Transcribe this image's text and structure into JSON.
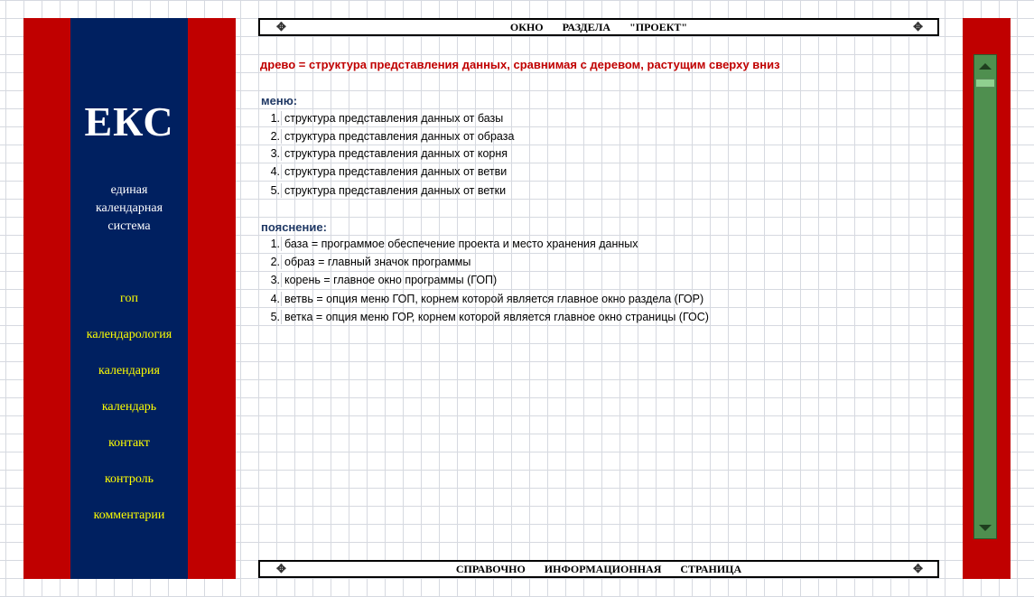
{
  "sidebar": {
    "logo": "ЕКС",
    "subtitle": [
      "единая",
      "календарная",
      "система"
    ],
    "nav": [
      "гоп",
      "календарология",
      "календария",
      "календарь",
      "контакт",
      "контроль",
      "комментарии"
    ]
  },
  "header": {
    "title": "ОКНО   РАЗДЕЛА   \"ПРОЕКТ\""
  },
  "footer": {
    "title": "СПРАВОЧНО   ИНФОРМАЦИОННАЯ   СТРАНИЦА"
  },
  "content": {
    "definition": "древо = структура представления данных, сравнимая с деревом, растущим сверху вниз",
    "menu_heading": "меню:",
    "menu_items": [
      {
        "num": "1.",
        "text": "структура представления данных от базы"
      },
      {
        "num": "2.",
        "text": "структура представления данных от образа"
      },
      {
        "num": "3.",
        "text": "структура представления данных от корня"
      },
      {
        "num": "4.",
        "text": "структура представления данных от ветви"
      },
      {
        "num": "5.",
        "text": "структура представления данных от ветки"
      }
    ],
    "explain_heading": "пояснение:",
    "explain_items": [
      {
        "num": "1.",
        "text": "база = программое обеспечение проекта и место хранения данных"
      },
      {
        "num": "2.",
        "text": "образ = главный значок программы"
      },
      {
        "num": "3.",
        "text": "корень = главное окно программы (ГОП)"
      },
      {
        "num": "4.",
        "text": "ветвь = опция меню ГОП, корнем которой является главное окно раздела (ГОР)"
      },
      {
        "num": "5.",
        "text": "ветка = опция меню ГОР, корнем которой является главное окно страницы (ГОС)"
      }
    ]
  },
  "icons": {
    "ornament": "compass-rose-icon",
    "scroll_up": "arrow-up-icon",
    "scroll_down": "arrow-down-icon"
  },
  "colors": {
    "red": "#c00000",
    "navy": "#002060",
    "nav_text": "#ffff00",
    "heading": "#1f3864",
    "scrollbar": "#4f8f4f"
  }
}
